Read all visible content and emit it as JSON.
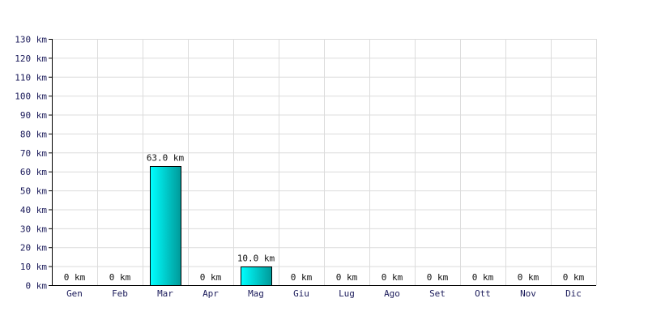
{
  "chart_data": {
    "type": "bar",
    "categories": [
      "Gen",
      "Feb",
      "Mar",
      "Apr",
      "Mag",
      "Giu",
      "Lug",
      "Ago",
      "Set",
      "Ott",
      "Nov",
      "Dic"
    ],
    "values": [
      0,
      0,
      63.0,
      0,
      10.0,
      0,
      0,
      0,
      0,
      0,
      0,
      0
    ],
    "value_labels": [
      "0 km",
      "0 km",
      "63.0 km",
      "0 km",
      "10.0 km",
      "0 km",
      "0 km",
      "0 km",
      "0 km",
      "0 km",
      "0 km",
      "0 km"
    ],
    "y_unit": "km",
    "ylim": [
      0,
      130
    ],
    "y_ticks": [
      0,
      10,
      20,
      30,
      40,
      50,
      60,
      70,
      80,
      90,
      100,
      110,
      120,
      130
    ],
    "grid": true,
    "colors": {
      "bar_fill_light": "#00ffff",
      "bar_fill_dark": "#009999",
      "grid": "#dcdcdc",
      "label_text": "#1a1a5a"
    }
  }
}
